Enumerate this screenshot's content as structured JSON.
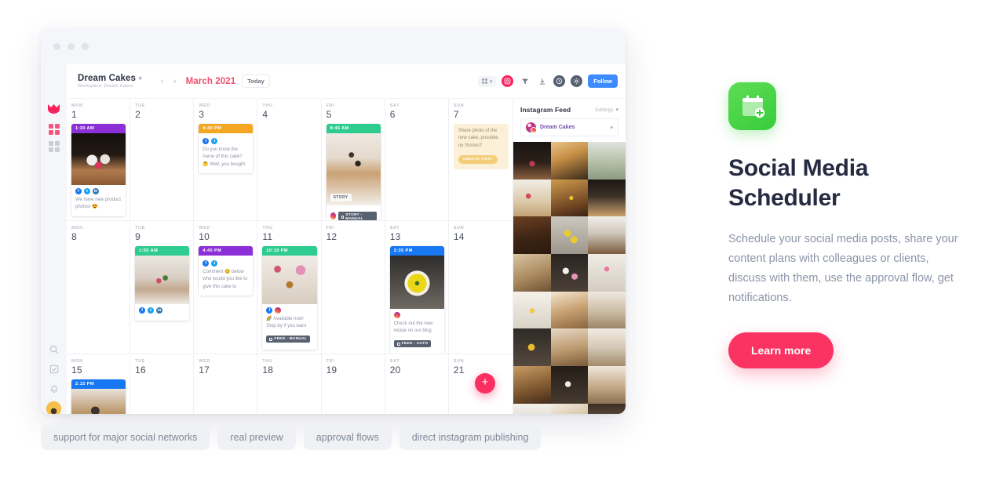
{
  "app": {
    "workspace": {
      "name": "Dream Cakes",
      "subtitle": "Workspace: Dream Cakes"
    },
    "nav": {
      "prev": "‹",
      "next": "›",
      "month": "March 2021",
      "today": "Today"
    },
    "toolbar": {
      "follow": "Follow"
    },
    "fab": "+",
    "weekdays": [
      "MON",
      "TUE",
      "WED",
      "THU",
      "FRI",
      "SAT",
      "SUN"
    ],
    "weeks": [
      {
        "days": [
          {
            "dow": "MON",
            "num": "1",
            "card": {
              "time": "1:30 AM",
              "color": "#8c2fd6",
              "image": "cupcake-raspberry",
              "socials": [
                "fb",
                "tw",
                "li"
              ],
              "text": "We have new product photos! 😍"
            }
          },
          {
            "dow": "TUE",
            "num": "2"
          },
          {
            "dow": "WED",
            "num": "3",
            "card": {
              "time": "4:40 PM",
              "color": "#f5a623",
              "socials": [
                "fb",
                "tw"
              ],
              "text": "Do you know the name of this cake? 🤔 Well, you  bought"
            }
          },
          {
            "dow": "THU",
            "num": "4"
          },
          {
            "dow": "FRI",
            "num": "5",
            "card": {
              "time": "8:45 AM",
              "color": "#2ecc8f",
              "image": "blueberry-cake",
              "story_tag": "STORY",
              "badge": "STORY - MANUAL",
              "badge_social": "ig"
            }
          },
          {
            "dow": "SAT",
            "num": "6"
          },
          {
            "dow": "SUN",
            "num": "7",
            "suggestion": {
              "text": "Share photo of the new cake, possible on Stories?",
              "button": "CREATE POST",
              "menu": "⋮"
            }
          }
        ]
      },
      {
        "days": [
          {
            "dow": "MON",
            "num": "8"
          },
          {
            "dow": "TUE",
            "num": "9",
            "card": {
              "time": "1:55 AM",
              "color": "#2ecc8f",
              "image": "pancakes-berries",
              "socials": [
                "fb",
                "tw",
                "li"
              ]
            }
          },
          {
            "dow": "WED",
            "num": "10",
            "card": {
              "time": "4:40 PM",
              "color": "#8c2fd6",
              "socials": [
                "fb",
                "tw"
              ],
              "text": "Comment 😊 below who would you like to give this cake to"
            }
          },
          {
            "dow": "THU",
            "num": "11",
            "card": {
              "time": "10:10 PM",
              "color": "#2ecc8f",
              "image": "breakfast-flatlay",
              "socials": [
                "fb",
                "ig"
              ],
              "text": "🌈 Available now! Stop by if you want",
              "badge": "FEED - MANUAL"
            }
          },
          {
            "dow": "FRI",
            "num": "12"
          },
          {
            "dow": "SAT",
            "num": "13",
            "card": {
              "time": "2:35 PM",
              "color": "#1877f2",
              "image": "lemon-tart",
              "socials": [
                "ig"
              ],
              "text": "Check out the new recipe on our blog",
              "badge": "FEED - AUTO"
            }
          },
          {
            "dow": "SUN",
            "num": "14"
          }
        ]
      },
      {
        "days": [
          {
            "dow": "MON",
            "num": "15",
            "card": {
              "time": "2:15 PM",
              "color": "#1877f2",
              "image": "layer-cake"
            }
          },
          {
            "dow": "TUE",
            "num": "16"
          },
          {
            "dow": "WED",
            "num": "17"
          },
          {
            "dow": "THU",
            "num": "18"
          },
          {
            "dow": "FRI",
            "num": "19"
          },
          {
            "dow": "SAT",
            "num": "20"
          },
          {
            "dow": "SUN",
            "num": "21"
          }
        ]
      }
    ],
    "instagram": {
      "title": "Instagram Feed",
      "settings": "Settings",
      "account": "Dream Cakes",
      "tiles": 24
    }
  },
  "promo": {
    "title_line1": "Social Media",
    "title_line2": "Scheduler",
    "description": "Schedule your social media posts, share your content plans with colleagues or clients, discuss with them, use the approval flow, get notifications.",
    "cta": "Learn more",
    "accent": "#fb3363",
    "icon_bg": "#37cc3b"
  },
  "tags": [
    "support for major social networks",
    "real preview",
    "approval flows",
    "direct instagram publishing"
  ]
}
